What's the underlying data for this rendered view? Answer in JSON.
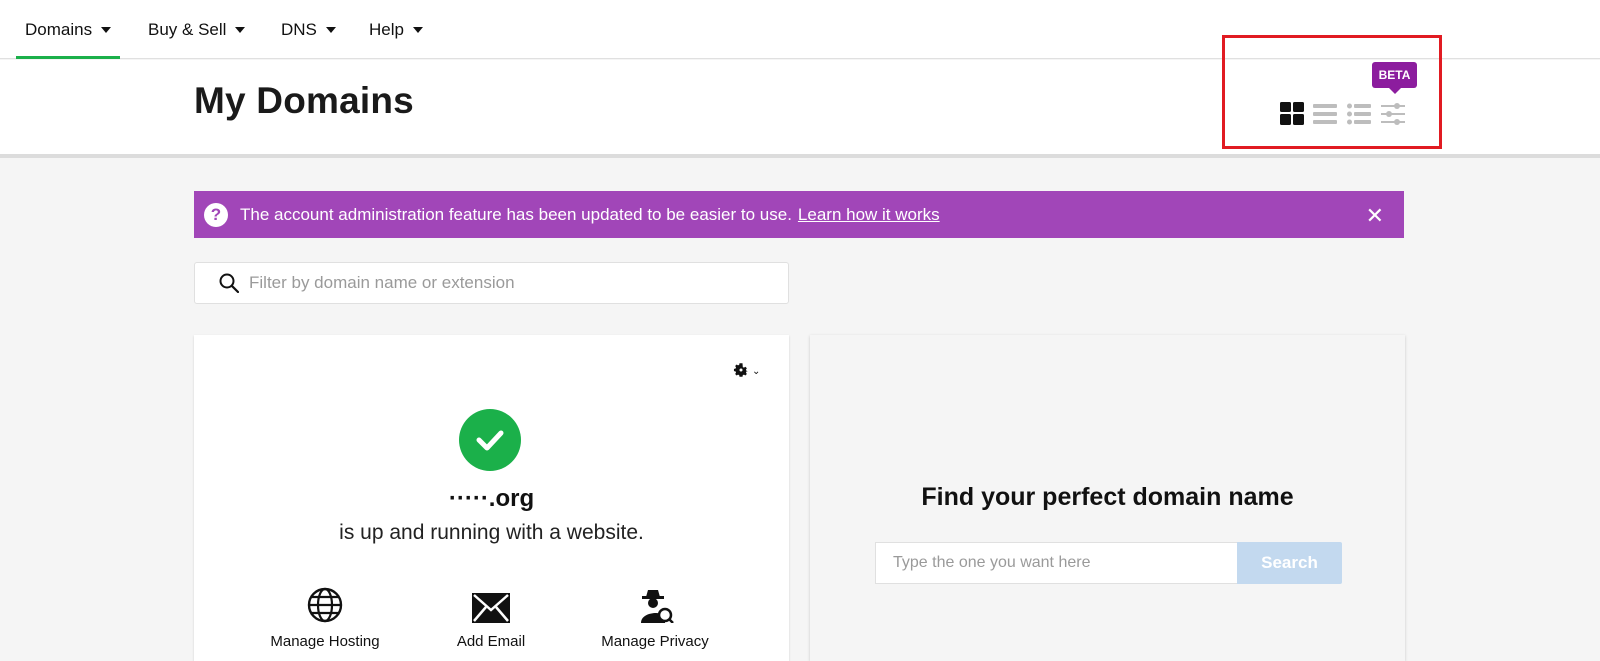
{
  "nav": {
    "items": [
      {
        "label": "Domains",
        "active": true
      },
      {
        "label": "Buy & Sell"
      },
      {
        "label": "DNS"
      },
      {
        "label": "Help"
      }
    ],
    "active_color": "#1bb04a"
  },
  "header": {
    "title": "My Domains",
    "beta_label": "BETA",
    "view_options": [
      "grid-view-icon",
      "list-view-icon",
      "detailed-list-view-icon",
      "filter-settings-icon"
    ],
    "selected_view": "grid-view-icon"
  },
  "banner": {
    "message": "The account administration feature has been updated to be easier to use.",
    "link": "Learn how it works",
    "color": "#a146b8"
  },
  "filter": {
    "placeholder": "Filter by domain name or extension"
  },
  "domain_card": {
    "domain": "·····.org",
    "status": "is up and running with a website.",
    "actions": [
      {
        "label": "Manage Hosting",
        "icon": "globe-icon"
      },
      {
        "label": "Add Email",
        "icon": "envelope-icon"
      },
      {
        "label": "Manage Privacy",
        "icon": "privacy-agent-icon"
      }
    ]
  },
  "search_card": {
    "title": "Find your perfect domain name",
    "placeholder": "Type the one you want here",
    "button": "Search"
  },
  "colors": {
    "success": "#1bb04a",
    "beta": "#8c1d9e",
    "highlight": "#e11b22"
  }
}
